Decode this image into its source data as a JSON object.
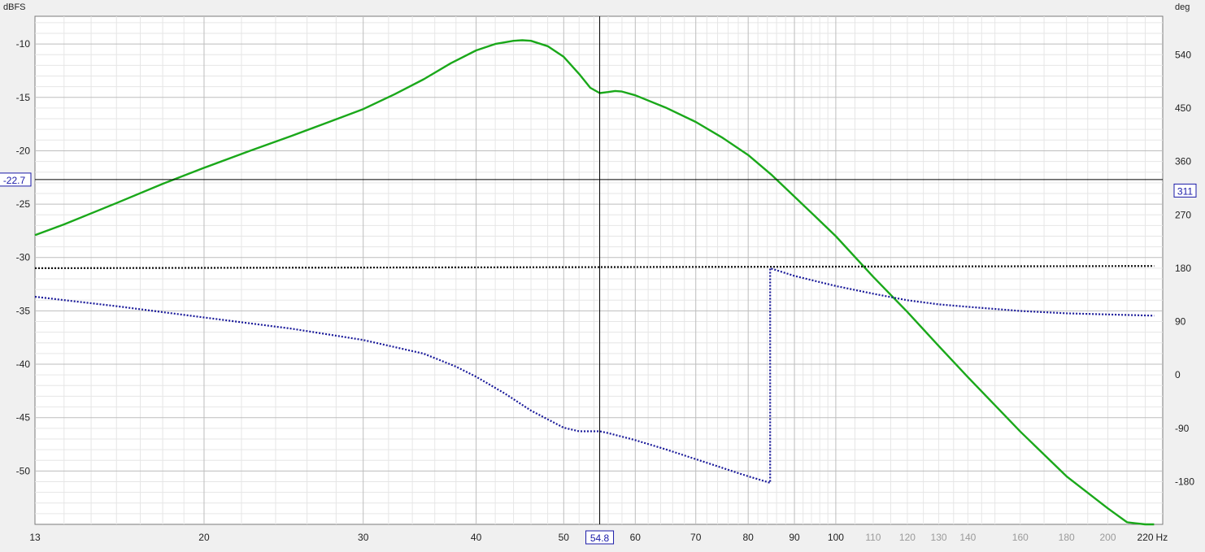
{
  "chart_data": {
    "type": "line",
    "y_left_unit": "dBFS",
    "y_right_unit": "deg",
    "x_unit": "Hz",
    "xscale": "log",
    "xlim": [
      13,
      230
    ],
    "ylim_left": [
      -55,
      -7.4
    ],
    "ylim_right": [
      -252,
      605
    ],
    "grid": true,
    "x_major_ticks": [
      13,
      20,
      30,
      40,
      50,
      60,
      70,
      80,
      90,
      100
    ],
    "x_minor_ticks": [
      110,
      120,
      130,
      140,
      160,
      180,
      200
    ],
    "x_last_tick": 220,
    "y_left_ticks": [
      -10,
      -15,
      -20,
      -25,
      -30,
      -35,
      -40,
      -45,
      -50
    ],
    "y_right_ticks": [
      540,
      450,
      360,
      270,
      180,
      90,
      0,
      -90,
      -180
    ],
    "cursor": {
      "x_label": "54.8",
      "x": 54.8,
      "y_left_label": "-22.7",
      "y_left": -22.7,
      "y_right_label": "311",
      "y_right": 311
    },
    "series": [
      {
        "axis": "left",
        "color": "#1aa81a",
        "style": "solid",
        "x": [
          13,
          14,
          16,
          18,
          20,
          22.5,
          25,
          27.5,
          30,
          32.5,
          35,
          37.5,
          40,
          42,
          44,
          45,
          46,
          48,
          50,
          52,
          53.5,
          54.8,
          56,
          57,
          58,
          60,
          65,
          70,
          75,
          80,
          85,
          90,
          95,
          100,
          110,
          120,
          130,
          140,
          160,
          180,
          200,
          210,
          220,
          225
        ],
        "values": [
          -27.9,
          -26.9,
          -24.9,
          -23.1,
          -21.6,
          -20.0,
          -18.6,
          -17.3,
          -16.1,
          -14.7,
          -13.3,
          -11.8,
          -10.6,
          -10.0,
          -9.7,
          -9.65,
          -9.7,
          -10.2,
          -11.2,
          -12.8,
          -14.1,
          -14.6,
          -14.5,
          -14.4,
          -14.45,
          -14.8,
          -16.0,
          -17.3,
          -18.8,
          -20.4,
          -22.3,
          -24.3,
          -26.2,
          -28.0,
          -31.8,
          -35.1,
          -38.3,
          -41.2,
          -46.3,
          -50.5,
          -53.5,
          -54.8,
          -56.0,
          -56.5
        ]
      },
      {
        "axis": "right",
        "color": "#1a1a9a",
        "style": "dotted",
        "x": [
          13,
          16,
          20,
          25,
          30,
          35,
          38,
          40,
          43,
          46,
          50,
          52,
          54.8,
          56,
          60,
          65,
          70,
          75,
          80,
          84.6,
          84.61,
          90,
          100,
          110,
          120,
          130,
          140,
          160,
          180,
          200,
          225
        ],
        "values": [
          132,
          116,
          97,
          78,
          59,
          36,
          14,
          -3,
          -31,
          -60,
          -89,
          -95,
          -95,
          -98,
          -110,
          -126,
          -142,
          -157,
          -171,
          -182,
          180,
          167,
          150,
          137,
          126,
          119,
          115,
          108,
          104,
          102,
          100
        ]
      },
      {
        "axis": "left",
        "color": "#111111",
        "style": "dotted",
        "x": [
          13,
          225
        ],
        "values": [
          -31.0,
          -30.8
        ]
      }
    ]
  }
}
